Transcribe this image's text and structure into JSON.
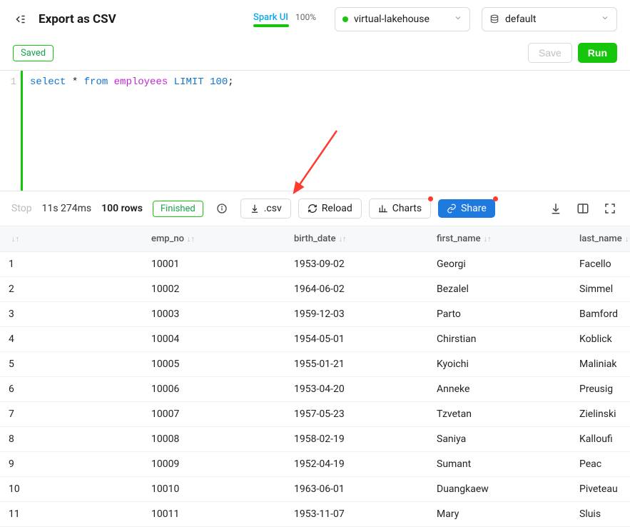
{
  "header": {
    "title": "Export as CSV",
    "spark_label": "Spark UI",
    "spark_pct": "100%",
    "conn_name": "virtual-lakehouse",
    "db_name": "default"
  },
  "actions": {
    "saved_badge": "Saved",
    "save_label": "Save",
    "run_label": "Run"
  },
  "editor": {
    "line_no": "1",
    "sql_select": "select",
    "sql_star": " * ",
    "sql_from": "from",
    "sql_table": " employees ",
    "sql_limit": "LIMIT",
    "sql_limit_n": " 100",
    "sql_semi": ";"
  },
  "results_toolbar": {
    "stop": "Stop",
    "elapsed": "11s 274ms",
    "rowcount": "100 rows",
    "finished": "Finished",
    "csv": ".csv",
    "reload": "Reload",
    "charts": "Charts",
    "share": "Share"
  },
  "columns": [
    "",
    "emp_no",
    "birth_date",
    "first_name",
    "last_name"
  ],
  "rows": [
    {
      "n": "1",
      "emp_no": "10001",
      "birth_date": "1953-09-02",
      "first_name": "Georgi",
      "last_name": "Facello"
    },
    {
      "n": "2",
      "emp_no": "10002",
      "birth_date": "1964-06-02",
      "first_name": "Bezalel",
      "last_name": "Simmel"
    },
    {
      "n": "3",
      "emp_no": "10003",
      "birth_date": "1959-12-03",
      "first_name": "Parto",
      "last_name": "Bamford"
    },
    {
      "n": "4",
      "emp_no": "10004",
      "birth_date": "1954-05-01",
      "first_name": "Chirstian",
      "last_name": "Koblick"
    },
    {
      "n": "5",
      "emp_no": "10005",
      "birth_date": "1955-01-21",
      "first_name": "Kyoichi",
      "last_name": "Maliniak"
    },
    {
      "n": "6",
      "emp_no": "10006",
      "birth_date": "1953-04-20",
      "first_name": "Anneke",
      "last_name": "Preusig"
    },
    {
      "n": "7",
      "emp_no": "10007",
      "birth_date": "1957-05-23",
      "first_name": "Tzvetan",
      "last_name": "Zielinski"
    },
    {
      "n": "8",
      "emp_no": "10008",
      "birth_date": "1958-02-19",
      "first_name": "Saniya",
      "last_name": "Kalloufi"
    },
    {
      "n": "9",
      "emp_no": "10009",
      "birth_date": "1952-04-19",
      "first_name": "Sumant",
      "last_name": "Peac"
    },
    {
      "n": "10",
      "emp_no": "10010",
      "birth_date": "1963-06-01",
      "first_name": "Duangkaew",
      "last_name": "Piveteau"
    },
    {
      "n": "11",
      "emp_no": "10011",
      "birth_date": "1953-11-07",
      "first_name": "Mary",
      "last_name": "Sluis"
    }
  ]
}
